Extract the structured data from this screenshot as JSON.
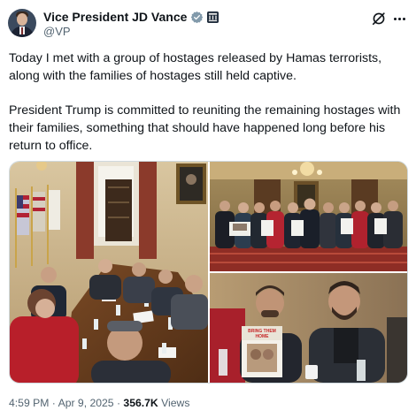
{
  "author": {
    "display_name": "Vice President JD Vance",
    "handle": "@VP",
    "verified_color": "#829aab",
    "avatar_icon": "profile-photo"
  },
  "tweet": {
    "paragraph_1": "Today I met with a group of hostages released by Hamas terrorists, along with the families of hostages still held captive.",
    "paragraph_2": "President Trump is committed to reuniting the remaining hostages with their families, something that should have happened long before his return to office."
  },
  "media": {
    "photos": [
      {
        "name": "meeting-room-photo"
      },
      {
        "name": "group-photo-with-signs"
      },
      {
        "name": "hostage-holding-poster-photo"
      }
    ],
    "poster_text": "BRING THEM HOME"
  },
  "footer": {
    "time": "4:59 PM",
    "separator": "·",
    "date": "Apr 9, 2025",
    "views_count": "356.7K",
    "views_label": "Views"
  },
  "colors": {
    "text_primary": "#0f1419",
    "text_secondary": "#536471",
    "border": "#cfd9de"
  }
}
